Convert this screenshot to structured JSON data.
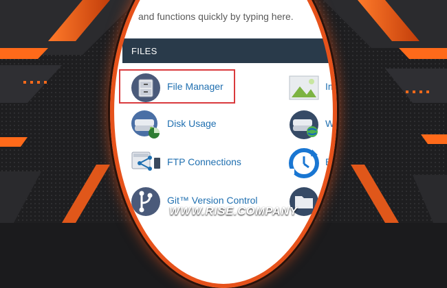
{
  "search": {
    "text": "and functions quickly by typing here."
  },
  "files": {
    "title": "FILES",
    "items": [
      {
        "label": "File Manager",
        "icon": "file-cabinet-icon"
      },
      {
        "label": "Disk Usage",
        "icon": "hard-drive-pie-icon"
      },
      {
        "label": "FTP Connections",
        "icon": "ftp-network-icon"
      },
      {
        "label": "Git™ Version Control",
        "icon": "git-branch-icon"
      },
      {
        "label": "Images",
        "visible_label": "Image",
        "icon": "image-icon"
      },
      {
        "label": "Web Disk",
        "visible_label": "Web D",
        "icon": "web-disk-icon"
      },
      {
        "label": "Backup",
        "visible_label": "Ba",
        "icon": "backup-clock-icon"
      },
      {
        "label": "",
        "icon": "folder-icon"
      }
    ]
  },
  "brand": {
    "text": "WWW.RISE.COMPANY"
  },
  "colors": {
    "accent": "#e6521b",
    "link": "#1f6fb0",
    "header": "#293a4a",
    "highlight": "#d9393c"
  }
}
